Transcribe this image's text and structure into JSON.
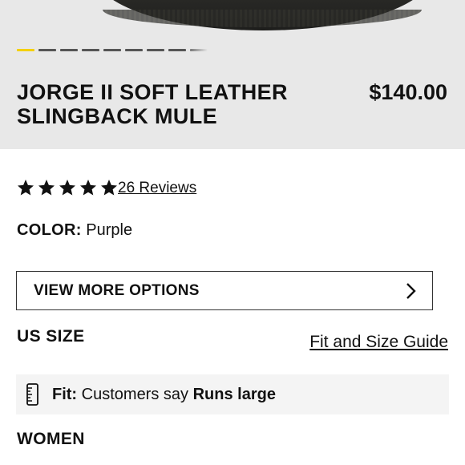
{
  "product": {
    "title": "JORGE II SOFT LEATHER SLINGBACK MULE",
    "price": "$140.00"
  },
  "carousel": {
    "total_dots": 9,
    "active_index": 0
  },
  "rating": {
    "stars": 5,
    "reviews_label": "26 Reviews"
  },
  "color": {
    "label": "COLOR:",
    "value": "Purple"
  },
  "options": {
    "label": "VIEW MORE OPTIONS"
  },
  "size": {
    "label": "US SIZE",
    "guide_link": "Fit and Size Guide"
  },
  "fit": {
    "label": "Fit:",
    "text": "Customers say",
    "value": "Runs large"
  },
  "section": {
    "women": "WOMEN"
  },
  "colors": {
    "active_dot": "#f4d000",
    "hero_bg": "#e8e8e8",
    "fit_bg": "#f4f4f4"
  }
}
